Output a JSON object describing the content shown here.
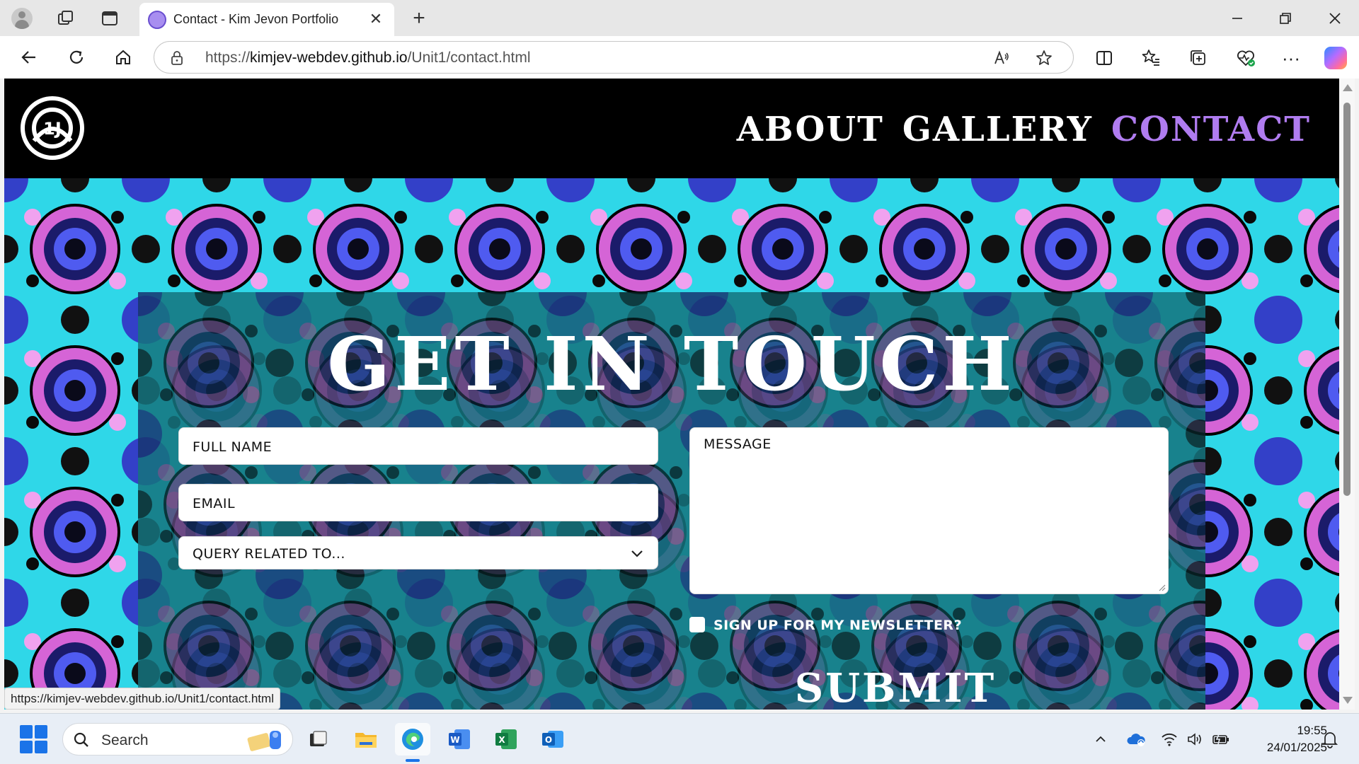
{
  "browser": {
    "tab_title": "Contact - Kim Jevon Portfolio",
    "tab_close": "✕",
    "new_tab": "+",
    "url_prefix": "https://",
    "url_host": "kimjev-webdev.github.io",
    "url_path": "/Unit1/contact.html",
    "read_aloud": "A̧",
    "more": "···",
    "status_url": "https://kimjev-webdev.github.io/Unit1/contact.html"
  },
  "site": {
    "nav": [
      {
        "label": "ABOUT",
        "active": false
      },
      {
        "label": "GALLERY",
        "active": false
      },
      {
        "label": "CONTACT",
        "active": true
      }
    ],
    "heading": "GET IN TOUCH",
    "form": {
      "full_name_placeholder": "FULL NAME",
      "email_placeholder": "EMAIL",
      "query_placeholder": "QUERY RELATED TO...",
      "message_placeholder": "MESSAGE",
      "newsletter_label": "SIGN UP FOR MY NEWSLETTER?",
      "newsletter_checked": false,
      "submit_label": "SUBMIT"
    }
  },
  "taskbar": {
    "search_label": "Search",
    "time": "19:55",
    "date": "24/01/2025"
  },
  "colors": {
    "nav_active": "#b07cf0",
    "panel": "#04303a",
    "pattern_cyan": "#2fe3f0",
    "pattern_pink": "#e76ee0",
    "pattern_blue": "#3340c8"
  }
}
